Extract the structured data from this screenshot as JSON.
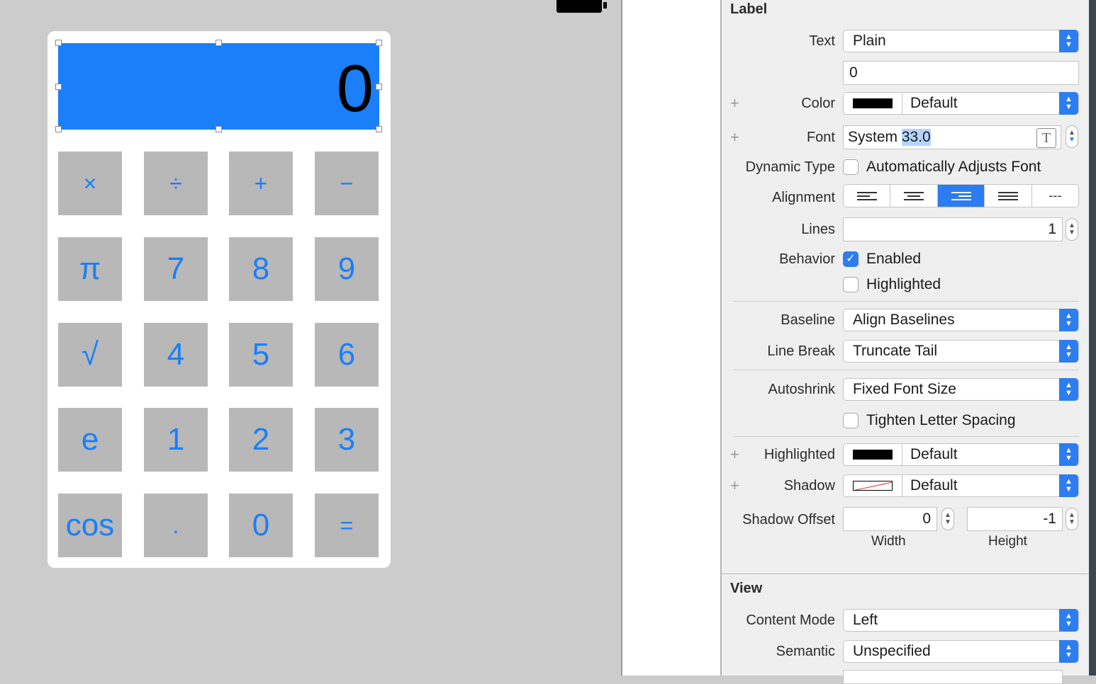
{
  "canvas": {
    "display_value": "0",
    "buttons": [
      [
        "×",
        "÷",
        "+",
        "−"
      ],
      [
        "π",
        "7",
        "8",
        "9"
      ],
      [
        "√",
        "4",
        "5",
        "6"
      ],
      [
        "e",
        "1",
        "2",
        "3"
      ],
      [
        "cos",
        ".",
        "0",
        "="
      ]
    ]
  },
  "inspector": {
    "label_section": {
      "title": "Label",
      "text_label": "Text",
      "text_type": "Plain",
      "text_value": "0",
      "color_label": "Color",
      "color_value": "Default",
      "font_label": "Font",
      "font_family": "System",
      "font_size": "33.0",
      "dynamic_type_label": "Dynamic Type",
      "dynamic_type_checkbox": "Automatically Adjusts Font",
      "alignment_label": "Alignment",
      "alignment_options": [
        "left",
        "center",
        "right",
        "justified",
        "natural"
      ],
      "alignment_selected": "right",
      "natural_glyph": "---",
      "lines_label": "Lines",
      "lines_value": "1",
      "behavior_label": "Behavior",
      "enabled_label": "Enabled",
      "enabled_checked": true,
      "highlighted_label": "Highlighted",
      "highlighted_checked": false,
      "baseline_label": "Baseline",
      "baseline_value": "Align Baselines",
      "line_break_label": "Line Break",
      "line_break_value": "Truncate Tail",
      "autoshrink_label": "Autoshrink",
      "autoshrink_value": "Fixed Font Size",
      "tighten_label": "Tighten Letter Spacing",
      "tighten_checked": false,
      "highlighted_color_label": "Highlighted",
      "highlighted_color_value": "Default",
      "shadow_label": "Shadow",
      "shadow_value": "Default",
      "shadow_offset_label": "Shadow Offset",
      "shadow_width": "0",
      "shadow_height": "-1",
      "width_label": "Width",
      "height_label": "Height"
    },
    "view_section": {
      "title": "View",
      "content_mode_label": "Content Mode",
      "content_mode_value": "Left",
      "semantic_label": "Semantic",
      "semantic_value": "Unspecified"
    }
  },
  "colors": {
    "accent": "#2c7df0",
    "display_bg": "#1a7ff8",
    "button_bg": "#b8b8b8",
    "button_text": "#1a7ff8"
  }
}
